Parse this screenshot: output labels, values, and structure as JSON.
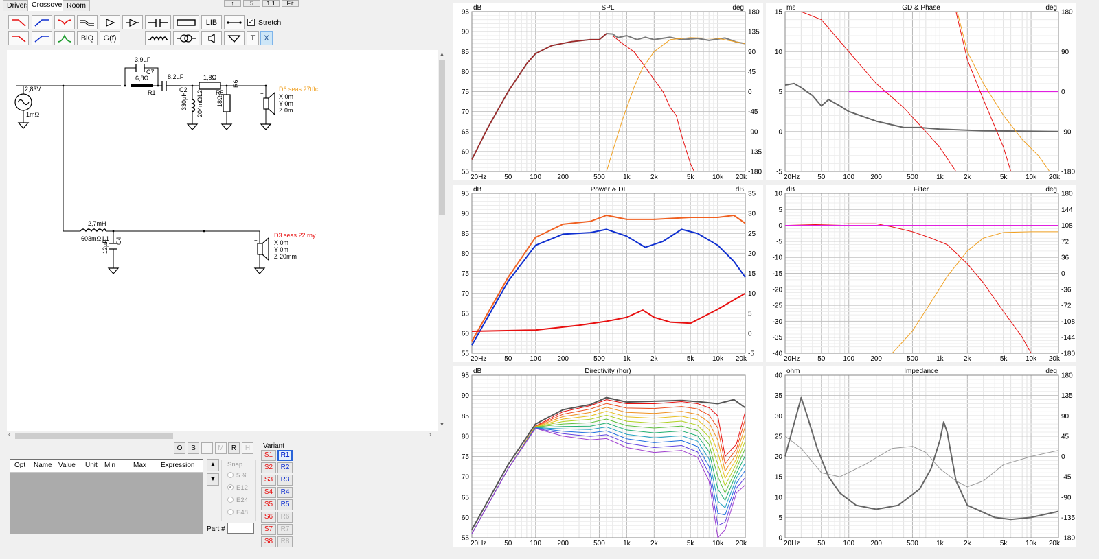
{
  "tabs": [
    {
      "label": "Drivers",
      "active": false
    },
    {
      "label": "Crossover",
      "active": true
    },
    {
      "label": "Room",
      "active": false
    }
  ],
  "top_buttons": [
    "↑",
    "5",
    "1:1",
    "Fit"
  ],
  "toolbar": {
    "biq_label": "BiQ",
    "gf_label": "G(f)",
    "lib_label": "LIB",
    "t_label": "T",
    "x_label": "X",
    "stretch_label": "Stretch",
    "stretch_checked": true
  },
  "schematic": {
    "source": {
      "voltage": "2,83V",
      "resistance": "1mΩ"
    },
    "components": {
      "c7": {
        "value": "3,9µF",
        "ref": "C7"
      },
      "r1": {
        "value": "6,8Ω",
        "ref": "R1"
      },
      "c2": {
        "value": "8,2µF",
        "ref": "C2"
      },
      "r5": {
        "value": "1,8Ω",
        "ref": "R5"
      },
      "l2": {
        "value": "330µH",
        "res": "204mΩ",
        "ref": "L2"
      },
      "r6": {
        "value": "18Ω",
        "ref": "R6"
      },
      "l1": {
        "value": "2,7mH",
        "res": "603mΩ",
        "ref": "L1"
      },
      "c4": {
        "value": "12µF",
        "ref": "C4"
      }
    },
    "driver_tweeter": {
      "name": "D6 seas 27tffc",
      "x": "X 0m",
      "y": "Y 0m",
      "z": "Z 0m",
      "color": "#f0a020"
    },
    "driver_woofer": {
      "name": "D3 seas 22 rny",
      "x": "X 0m",
      "y": "Y 0m",
      "z": "Z 20mm",
      "color": "#e81010"
    }
  },
  "optimizer": {
    "buttons": [
      {
        "label": "O",
        "enabled": true
      },
      {
        "label": "S",
        "enabled": true
      },
      {
        "label": "I",
        "enabled": false
      },
      {
        "label": "M",
        "enabled": false
      },
      {
        "label": "R",
        "enabled": true
      },
      {
        "label": "H",
        "enabled": false
      }
    ],
    "columns": [
      "Opt",
      "Name",
      "Value",
      "Unit",
      "Min",
      "Max",
      "Expression"
    ],
    "snap_label": "Snap",
    "snap_options": [
      {
        "label": "5 %",
        "selected": false
      },
      {
        "label": "E12",
        "selected": true
      },
      {
        "label": "E24",
        "selected": false
      },
      {
        "label": "E48",
        "selected": false
      }
    ],
    "part_label": "Part #",
    "part_value": ""
  },
  "variant": {
    "label": "Variant",
    "s_buttons": [
      "S1",
      "S2",
      "S3",
      "S4",
      "S5",
      "S6",
      "S7",
      "S8"
    ],
    "r_buttons": [
      "R1",
      "R2",
      "R3",
      "R4",
      "R5",
      "R6",
      "R7",
      "R8"
    ],
    "r_selected": "R1",
    "r_enabled_count": 5
  },
  "charts": {
    "spl": {
      "title": "SPL",
      "left_unit": "dB",
      "right_unit": "deg",
      "y_ticks": [
        "95",
        "90",
        "85",
        "80",
        "75",
        "70",
        "65",
        "60",
        "55"
      ],
      "y2_ticks": [
        "180",
        "135",
        "90",
        "45",
        "0",
        "-45",
        "-90",
        "-135",
        "-180"
      ]
    },
    "gd_phase": {
      "title": "GD & Phase",
      "left_unit": "ms",
      "right_unit": "deg",
      "y_ticks": [
        "15",
        "10",
        "5",
        "0",
        "-5"
      ],
      "y2_ticks": [
        "180",
        "90",
        "0",
        "-90",
        "-180"
      ]
    },
    "power_di": {
      "title": "Power & DI",
      "left_unit": "dB",
      "right_unit": "dB",
      "y_ticks": [
        "95",
        "90",
        "85",
        "80",
        "75",
        "70",
        "65",
        "60",
        "55"
      ],
      "y2_ticks": [
        "35",
        "30",
        "25",
        "20",
        "15",
        "10",
        "5",
        "0",
        "-5"
      ]
    },
    "filter": {
      "title": "Filter",
      "left_unit": "dB",
      "right_unit": "deg",
      "y_ticks": [
        "10",
        "5",
        "0",
        "-5",
        "-10",
        "-15",
        "-20",
        "-25",
        "-30",
        "-35",
        "-40"
      ],
      "y2_ticks": [
        "180",
        "144",
        "108",
        "72",
        "36",
        "0",
        "-36",
        "-72",
        "-108",
        "-144",
        "-180"
      ]
    },
    "directivity": {
      "title": "Directivity (hor)",
      "left_unit": "dB",
      "right_unit": "",
      "y_ticks": [
        "95",
        "90",
        "85",
        "80",
        "75",
        "70",
        "65",
        "60",
        "55"
      ],
      "y2_ticks": []
    },
    "impedance": {
      "title": "Impedance",
      "left_unit": "ohm",
      "right_unit": "deg",
      "y_ticks": [
        "40",
        "35",
        "30",
        "25",
        "20",
        "15",
        "10",
        "5",
        "0"
      ],
      "y2_ticks": [
        "180",
        "135",
        "90",
        "45",
        "0",
        "-45",
        "-90",
        "-135",
        "-180"
      ]
    },
    "x_ticks": [
      "20Hz",
      "50",
      "100",
      "200",
      "500",
      "1k",
      "2k",
      "5k",
      "10k",
      "20k"
    ]
  },
  "colors": {
    "accent": "#e81010",
    "blue": "#1030d0",
    "orange": "#f0a020",
    "gray": "#6a6a6a",
    "magenta": "#e020e0"
  }
}
